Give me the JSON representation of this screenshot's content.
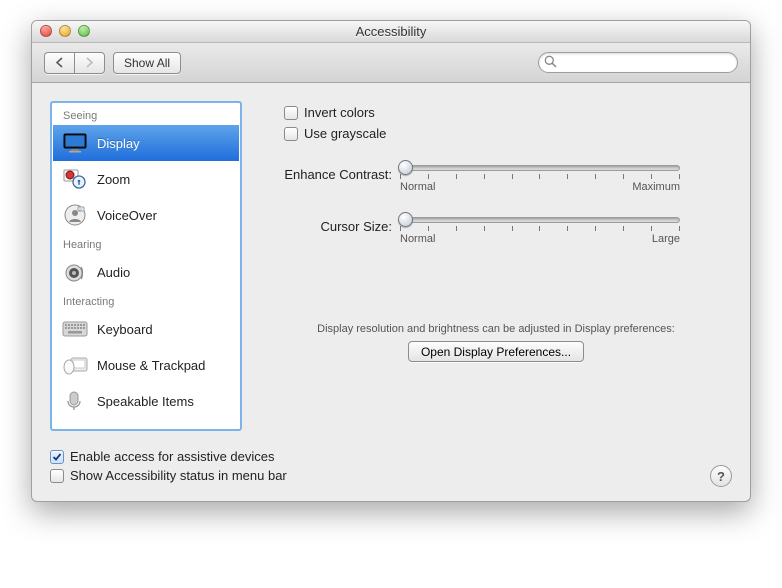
{
  "window": {
    "title": "Accessibility"
  },
  "toolbar": {
    "show_all": "Show All",
    "search_placeholder": ""
  },
  "sidebar": {
    "sections": [
      {
        "header": "Seeing",
        "items": [
          {
            "id": "display",
            "label": "Display",
            "selected": true
          },
          {
            "id": "zoom",
            "label": "Zoom"
          },
          {
            "id": "voiceover",
            "label": "VoiceOver"
          }
        ]
      },
      {
        "header": "Hearing",
        "items": [
          {
            "id": "audio",
            "label": "Audio"
          }
        ]
      },
      {
        "header": "Interacting",
        "items": [
          {
            "id": "keyboard",
            "label": "Keyboard"
          },
          {
            "id": "mouse",
            "label": "Mouse & Trackpad"
          },
          {
            "id": "speakable",
            "label": "Speakable Items"
          }
        ]
      }
    ]
  },
  "main": {
    "invert_colors": {
      "label": "Invert colors",
      "checked": false
    },
    "use_grayscale": {
      "label": "Use grayscale",
      "checked": false
    },
    "contrast": {
      "label": "Enhance Contrast:",
      "min_label": "Normal",
      "max_label": "Maximum",
      "value_pct": 0
    },
    "cursor": {
      "label": "Cursor Size:",
      "min_label": "Normal",
      "max_label": "Large",
      "value_pct": 0
    },
    "footnote": "Display resolution and brightness can be adjusted in Display preferences:",
    "open_prefs_btn": "Open Display Preferences..."
  },
  "bottom": {
    "enable_assistive": {
      "label": "Enable access for assistive devices",
      "checked": true
    },
    "status_menubar": {
      "label": "Show Accessibility status in menu bar",
      "checked": false
    }
  }
}
